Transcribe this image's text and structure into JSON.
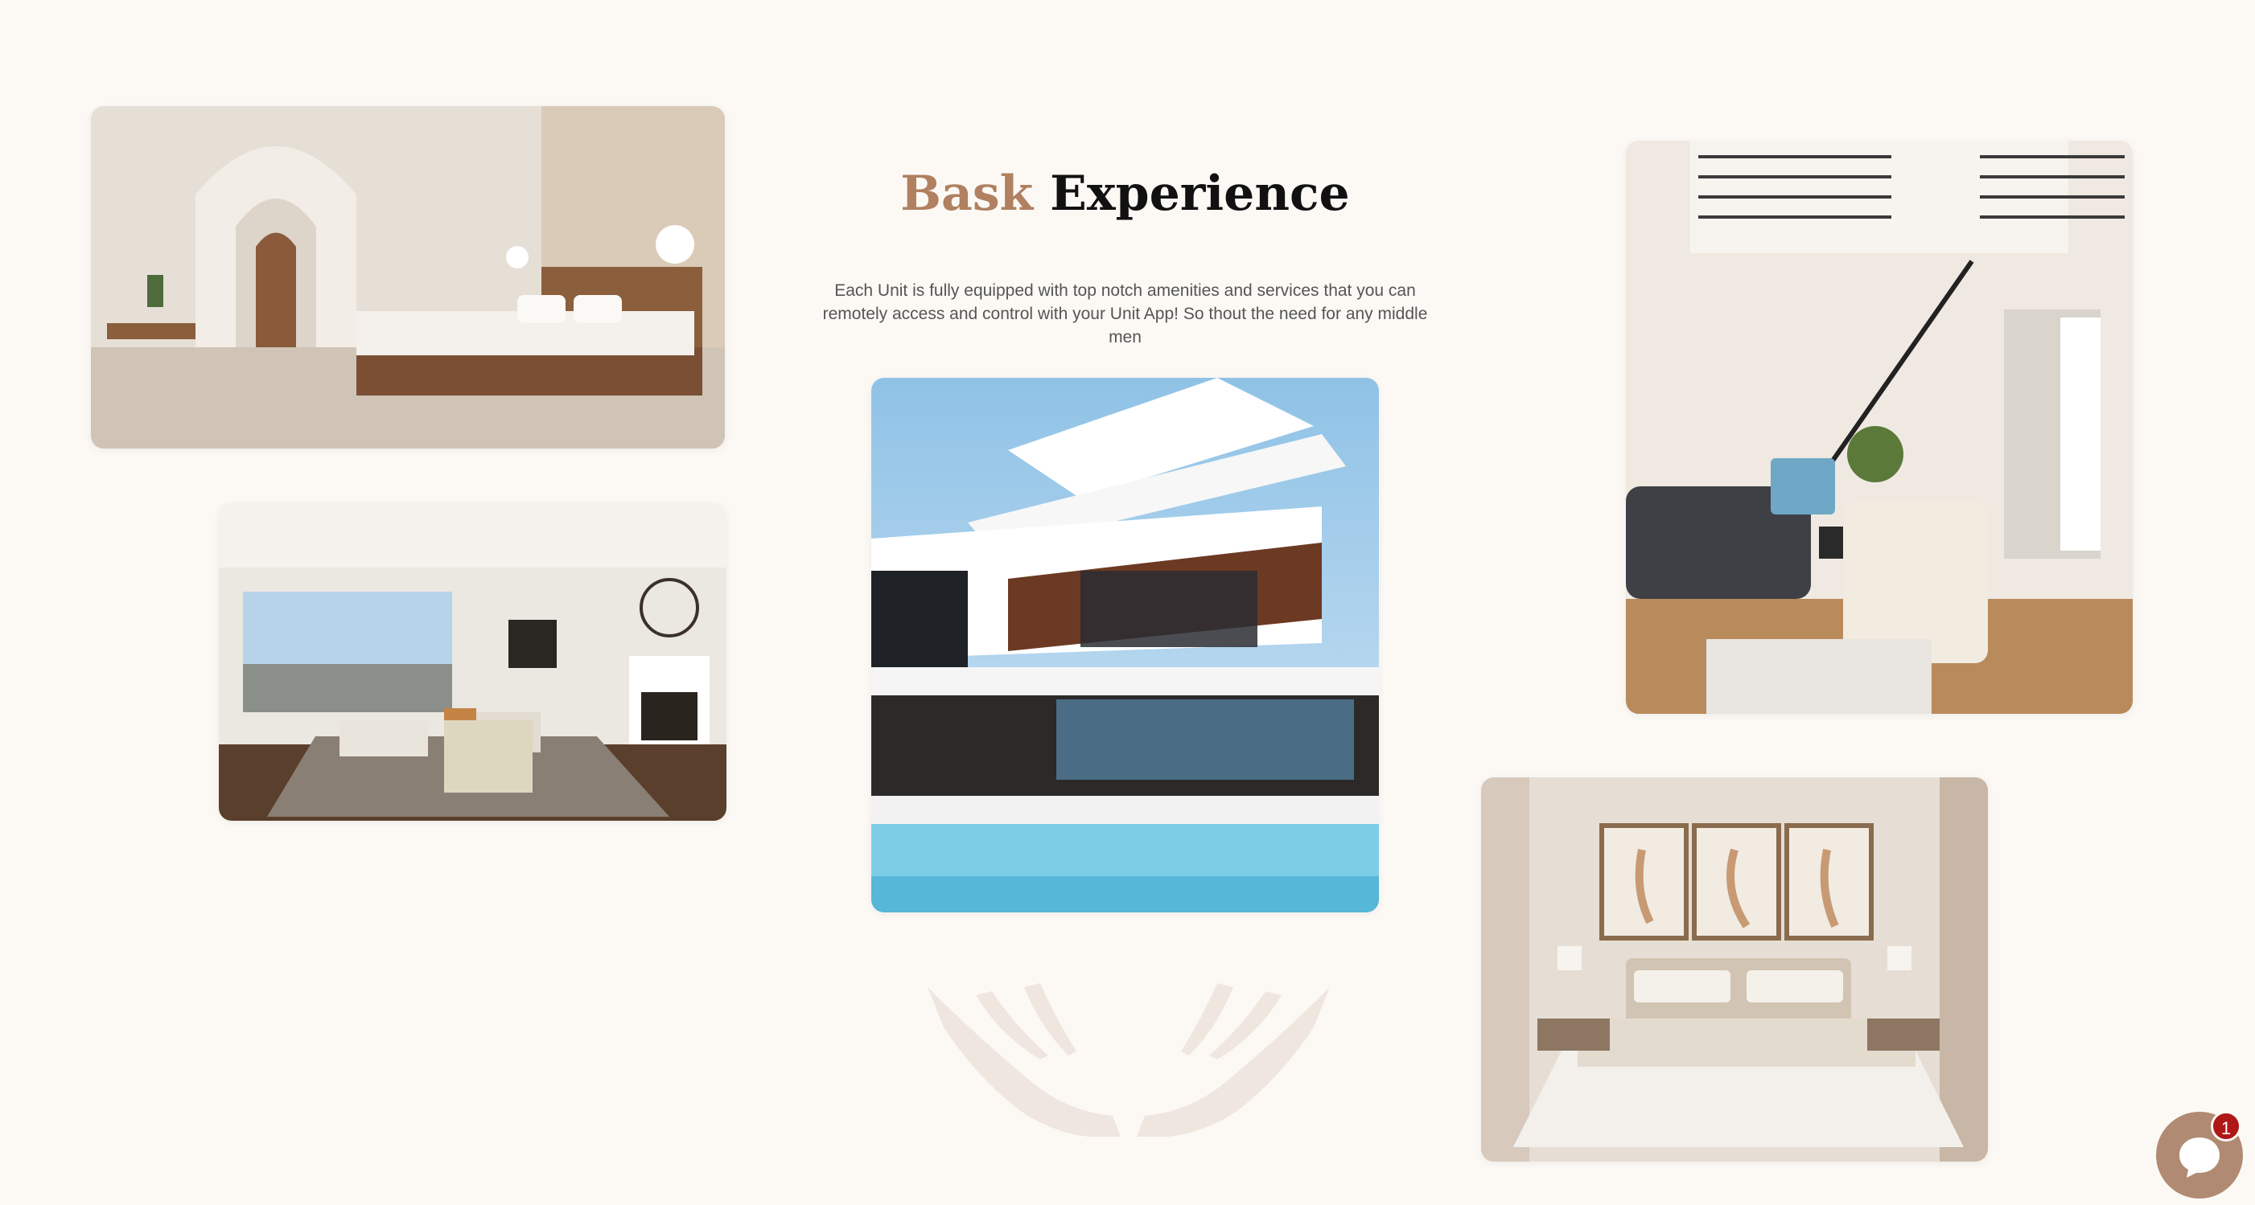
{
  "hero": {
    "title_accent": "Bask",
    "title_rest": "Experience",
    "description": "Each Unit is fully equipped with top notch amenities and services that you can remotely access and control with your Unit App! So thout the need for any middle men"
  },
  "chat": {
    "icon": "chat-bubble-icon",
    "badge_count": "1"
  },
  "colors": {
    "background": "#fcf9f5",
    "accent": "#b08060",
    "chat_button": "#b08a72",
    "badge": "#b01818"
  }
}
